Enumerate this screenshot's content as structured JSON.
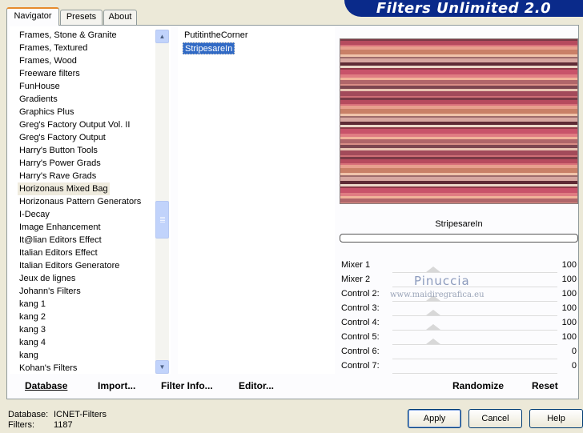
{
  "window": {
    "title": "Filters Unlimited 2.0"
  },
  "tabs": [
    {
      "label": "Navigator"
    },
    {
      "label": "Presets"
    },
    {
      "label": "About"
    }
  ],
  "categories": [
    "Frames, Stone & Granite",
    "Frames, Textured",
    "Frames, Wood",
    "Freeware filters",
    "FunHouse",
    "Gradients",
    "Graphics Plus",
    "Greg's Factory Output Vol. II",
    "Greg's Factory Output",
    "Harry's Button Tools",
    "Harry's Power Grads",
    "Harry's Rave Grads",
    "Horizonaus Mixed Bag",
    "Horizonaus Pattern Generators",
    "I-Decay",
    "Image Enhancement",
    "It@lian Editors Effect",
    "Italian Editors Effect",
    "Italian Editors Generatore",
    "Jeux de lignes",
    "Johann's Filters",
    "kang 1",
    "kang 2",
    "kang 3",
    "kang 4",
    "kang",
    "Kohan's Filters"
  ],
  "selected_category_index": 12,
  "filters": [
    {
      "label": "PutitintheCorner",
      "selected": false
    },
    {
      "label": "StripesareIn",
      "selected": true
    }
  ],
  "preview": {
    "preset_name": "StripesareIn",
    "progress": 0,
    "stripe_colors": [
      "#7a3a46",
      "#b64b5e",
      "#d9707a",
      "#e8a08e",
      "#c98067",
      "#f0c3aa",
      "#9e6b6b",
      "#d7a7a0",
      "#5e2b35",
      "#ebd7c8",
      "#8e3a48",
      "#c8536a",
      "#e07c82",
      "#f1b39a",
      "#b0666a",
      "#d98e86",
      "#7d4650",
      "#e9c4b2",
      "#a24a5a",
      "#cf6f76"
    ]
  },
  "controls": [
    {
      "label": "Mixer 1",
      "value": "100"
    },
    {
      "label": "Mixer 2",
      "value": "100"
    },
    {
      "label": "Control 2:",
      "value": "100"
    },
    {
      "label": "Control 3:",
      "value": "100"
    },
    {
      "label": "Control 4:",
      "value": "100"
    },
    {
      "label": "Control 5:",
      "value": "100"
    },
    {
      "label": "Control 6:",
      "value": "0"
    },
    {
      "label": "Control 7:",
      "value": "0"
    }
  ],
  "watermark": {
    "name": "Pinuccia",
    "url": "www.maidiregrafica.eu"
  },
  "actions": {
    "database": "Database",
    "import": "Import...",
    "filter_info": "Filter Info...",
    "editor": "Editor...",
    "randomize": "Randomize",
    "reset": "Reset"
  },
  "status": {
    "database_label": "Database:",
    "database_value": "ICNET-Filters",
    "filters_label": "Filters:",
    "filters_value": "1187"
  },
  "buttons": {
    "apply": "Apply",
    "cancel": "Cancel",
    "help": "Help"
  },
  "icons": {
    "scroll_up": "chevron-up-icon",
    "scroll_down": "chevron-down-icon"
  }
}
